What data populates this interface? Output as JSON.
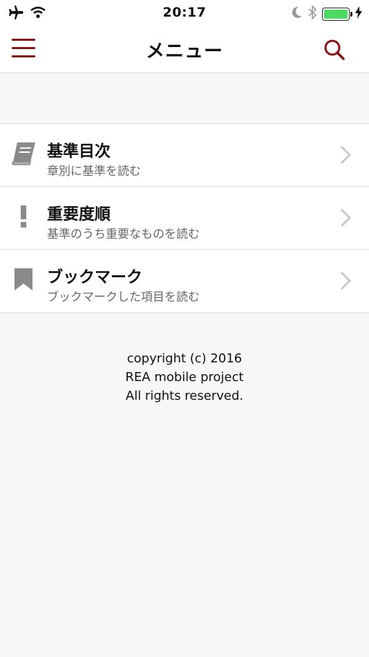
{
  "status_bar": {
    "time": "20:17",
    "icons": [
      "airplane-icon",
      "wifi-icon",
      "moon-icon",
      "bluetooth-icon",
      "battery-icon",
      "charging-icon"
    ],
    "battery_color": "#4cd964"
  },
  "navbar": {
    "title": "メニュー",
    "menu_icon": "hamburger-icon",
    "search_icon": "search-icon",
    "accent_color": "#8b1010"
  },
  "menu": {
    "items": [
      {
        "title": "基準目次",
        "subtitle": "章別に基準を読む",
        "icon": "book-icon"
      },
      {
        "title": "重要度順",
        "subtitle": "基準のうち重要なものを読む",
        "icon": "exclamation-icon"
      },
      {
        "title": "ブックマーク",
        "subtitle": "ブックマークした項目を読む",
        "icon": "bookmark-icon"
      }
    ]
  },
  "footer": {
    "line1": "copyright (c) 2016",
    "line2": "REA mobile project",
    "line3": "All rights reserved."
  }
}
